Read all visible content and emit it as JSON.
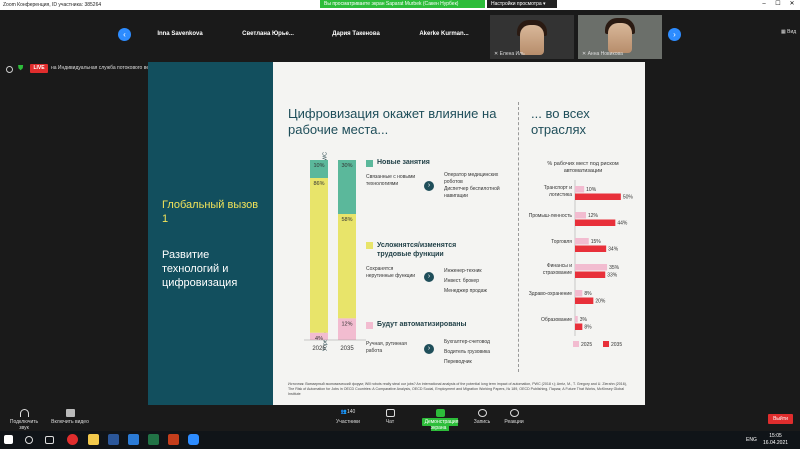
{
  "window": {
    "title": "Zoom Конференция, ID участника: 385264"
  },
  "share_banner": "Вы просматриваете экран Saparat Murbek (Сакен Нурбек)",
  "view_options": "Настройки просмотра",
  "participants": [
    {
      "name": "Inna Savenkova"
    },
    {
      "name": "Светлана Юрье..."
    },
    {
      "name": "Дария Такенова"
    },
    {
      "name": "Akerke Kurman..."
    }
  ],
  "video_participants": [
    {
      "name": "Елена Иль"
    },
    {
      "name": "Анна Новикова"
    }
  ],
  "view_label": "Вид",
  "live": {
    "badge": "LIVE",
    "text": "на Индивидуальная служба потокового вещания"
  },
  "slide": {
    "left": {
      "challenge": "Глобальный вызов 1",
      "topic": "Развитие технологий и цифровизация"
    },
    "main_title": "Цифровизация окажет влияние на рабочие места...",
    "right_title": "... во всех отраслях",
    "y_axis_label": "Усредненная оценка по миру на основе данных ОЭСР, ВЭФ, Маккинзи и PWC",
    "sections": [
      {
        "label": "Новые занятия",
        "color": "#5bb89b",
        "left_text": "Связанные с новыми технологиями",
        "right_text": [
          "Оператор медицинских роботов",
          "Диспетчер беспилотной навигации"
        ]
      },
      {
        "label": "Усложнятся/изменятся трудовые функции",
        "color": "#e8e46a",
        "left_text": "Сохранятся нерутинные функции",
        "right_text": [
          "Инженер-техник",
          "Инвест. брокер",
          "Менеджер продаж"
        ]
      },
      {
        "label": "Будут автоматизированы",
        "color": "#f2bcd0",
        "left_text": "Ручная, рутинная работа",
        "right_text": [
          "Бухгалтер-счетовод",
          "Водитель грузовика",
          "Переводчик"
        ]
      }
    ],
    "source": "Источник: Всемирный экономический форум; Will robots really steal our jobs? An international analysis of the potential long term impact of automation, PWC (2018 г.); Arntz, M., T. Gregory and U. Zierahn (2016), The Risk of Automation for Jobs in OECD Countries: A Comparative Analysis, OECD Social, Employment and Migration Working Papers, № 189, OECD Publishing, Париж; A Future That Works, McKinsey Global Institute"
  },
  "chart_data": [
    {
      "type": "bar",
      "categories": [
        "2025",
        "2035"
      ],
      "series": [
        {
          "name": "Новые занятия",
          "values": [
            10,
            30
          ],
          "labels": [
            "10%",
            "30%"
          ],
          "color": "#5bb89b"
        },
        {
          "name": "Усложнятся/изменятся трудовые функции",
          "values": [
            86,
            58
          ],
          "labels": [
            "86%",
            "58%"
          ],
          "color": "#e8e46a"
        },
        {
          "name": "Будут автоматизированы",
          "values": [
            4,
            12
          ],
          "labels": [
            "4%",
            "12%"
          ],
          "color": "#f2bcd0"
        }
      ],
      "stacked": true,
      "ylim": [
        0,
        100
      ]
    },
    {
      "type": "bar",
      "orientation": "horizontal",
      "title": "% рабочих мест под риском автоматизации",
      "categories": [
        "Транспорт и логистика",
        "Промыш-ленность",
        "Торговля",
        "Финансы и страхование",
        "Здраво-охранение",
        "Образование"
      ],
      "series": [
        {
          "name": "2025",
          "values": [
            10,
            12,
            15,
            35,
            8,
            3
          ],
          "color": "#f2bcd0"
        },
        {
          "name": "2035",
          "values": [
            50,
            44,
            34,
            33,
            20,
            8
          ],
          "color": "#e8303a"
        }
      ],
      "legend": "bottom",
      "xlim": [
        0,
        60
      ]
    }
  ],
  "controls": {
    "audio": "Подключить звук",
    "video": "Включить видео",
    "participants": "Участники",
    "participants_count": "140",
    "chat": "Чат",
    "share": "Демонстрация экрана",
    "record": "Запись",
    "reactions": "Реакции",
    "exit": "Выйти"
  },
  "taskbar": {
    "lang": "ENG",
    "time": "15:05",
    "date": "16.04.2021"
  }
}
